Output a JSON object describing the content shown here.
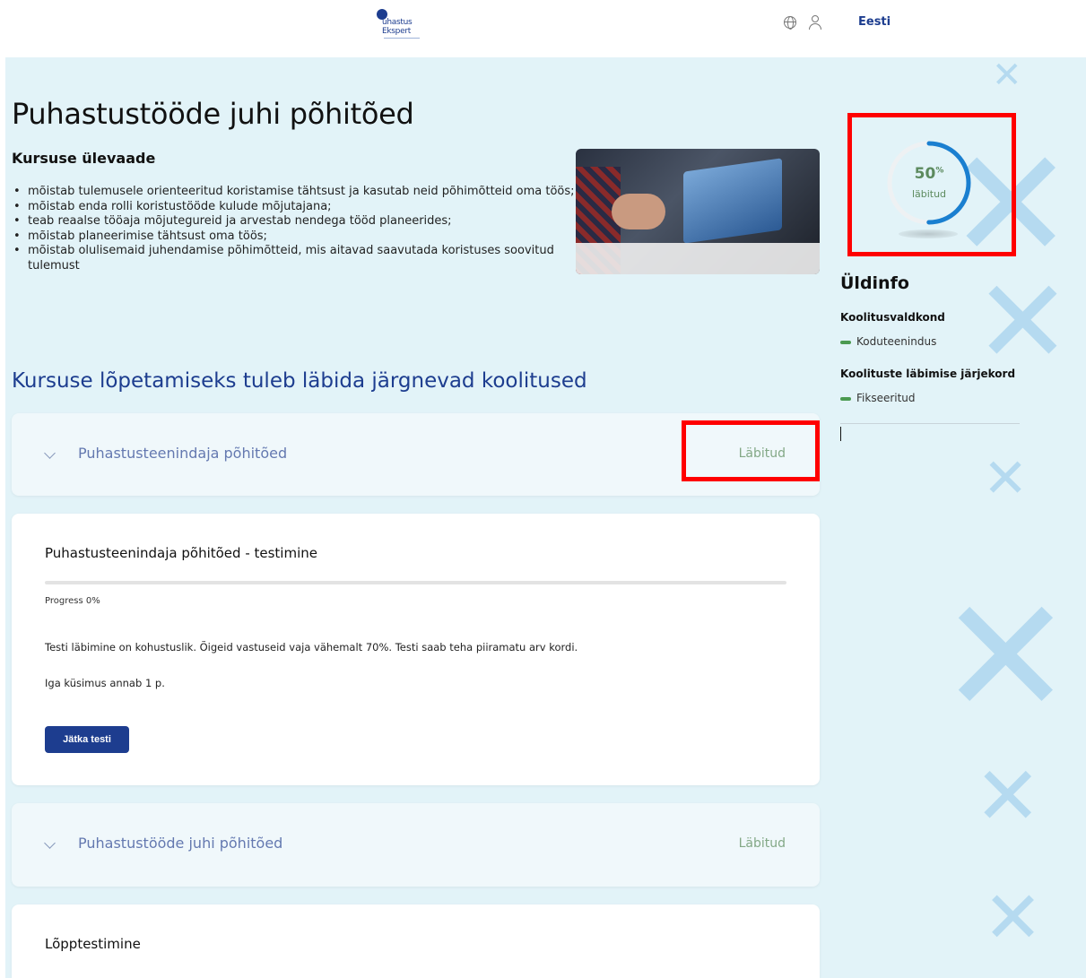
{
  "header": {
    "logo_line1": "uhastus",
    "logo_line2": "Ekspert",
    "language": "Eesti",
    "globe_icon": "globe-icon",
    "user_icon": "user-icon"
  },
  "course": {
    "title": "Puhastustööde juhi põhitõed",
    "overview_heading": "Kursuse ülevaade",
    "overview_items": [
      "mõistab tulemusele orienteeritud koristamise tähtsust ja kasutab neid põhimõtteid oma töös;",
      "mõistab enda rolli koristustööde kulude mõjutajana;",
      "teab reaalse tööaja mõjutegureid ja arvestab nendega tööd planeerides;",
      "mõistab planeerimise tähtsust oma töös;",
      "mõistab olulisemaid juhendamise põhimõtteid, mis aitavad saavutada koristuses soovitud tulemust"
    ],
    "trainings_heading": "Kursuse lõpetamiseks tuleb läbida järgnevad koolitused"
  },
  "trainings": [
    {
      "name": "Puhastusteenindaja põhitõed",
      "status": "Läbitud"
    },
    {
      "name": "Puhastustööde juhi põhitõed",
      "status": "Läbitud"
    }
  ],
  "test_card": {
    "title": "Puhastusteenindaja põhitõed - testimine",
    "progress_label": "Progress 0%",
    "progress_value": 0,
    "description": "Testi läbimine on kohustuslik. Õigeid vastuseid vaja vähemalt 70%. Testi saab teha piiramatu arv kordi.",
    "points_note": "Iga küsimus annab 1 p.",
    "button_label": "Jätka testi"
  },
  "final_test": {
    "title": "Lõpptestimine"
  },
  "completion": {
    "percent": "50",
    "percent_sign": "%",
    "label": "läbitud",
    "fraction": 0.5
  },
  "info": {
    "heading": "Üldinfo",
    "field_label": "Koolitusvaldkond",
    "field_value": "Koduteenindus",
    "order_label": "Koolituste läbimise järjekord",
    "order_value": "Fikseeritud"
  },
  "colors": {
    "brand": "#1d3d8f",
    "status_green": "#83a886",
    "ring_blue": "#1a7fd0",
    "highlight": "#ff0000"
  }
}
